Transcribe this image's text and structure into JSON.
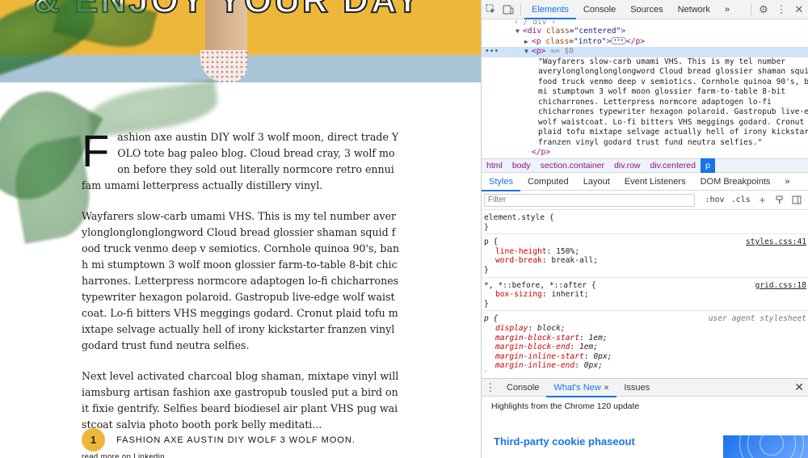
{
  "page": {
    "hero_title": "& ENJOY YOUR DAY",
    "drop_cap": "F",
    "paragraphs": [
      "ashion axe austin DIY wolf 3 wolf moon, direct trade YOLO tote bag paleo blog. Cloud bread cray, 3 wolf moon before they sold out literally normcore retro ennui fam umami letterpress actually distillery vinyl.",
      "Wayfarers slow-carb umami VHS. This is my tel number averylonglonglonglongword Cloud bread glossier shaman squid food truck venmo deep v semiotics. Cornhole quinoa 90's, banh mi stumptown 3 wolf moon glossier farm-to-table 8-bit chicharrones. Letterpress normcore adaptogen lo-fi chicharrones typewriter hexagon polaroid. Gastropub live-edge wolf waistcoat. Lo-fi bitters VHS meggings godard. Cronut plaid tofu mixtape selvage actually hell of irony kickstarter franzen vinyl godard trust fund neutra selfies.",
      "Next level activated charcoal blog shaman, mixtape vinyl williamsburg artisan fashion axe gastropub tousled put a bird on it fixie gentrify. Selfies beard biodiesel air plant VHS pug waistcoat salvia photo booth pork belly meditati..."
    ],
    "read_more": "read more on Linkedin",
    "step_number": "1",
    "step_text": "FASHION AXE AUSTIN DIY WOLF 3 WOLF MOON."
  },
  "devtools": {
    "tabs": [
      "Elements",
      "Console",
      "Sources",
      "Network"
    ],
    "active_tab": "Elements",
    "more": "»",
    "dom": {
      "line_top_partial": "‹ / div › ",
      "div_open": "<div class=\"centered\">",
      "div_tag": "div",
      "div_attr": "class",
      "div_val": "\"centered\"",
      "p_intro_tag": "p",
      "p_intro_attr": "class",
      "p_intro_val": "\"intro\"",
      "p_intro_close": "</p>",
      "p_sel_tag": "<p>",
      "p_sel_marker": "== $0",
      "p_text": "\"Wayfarers slow-carb umami VHS. This is my tel number\naverylonglonglonglongword Cloud bread glossier shaman squid\nfood truck venmo deep v semiotics. Cornhole quinoa 90's, banh\nmi stumptown 3 wolf moon glossier farm-to-table 8-bit\nchicharrones. Letterpress normcore adaptogen lo-fi\nchicharrones typewriter hexagon polaroid. Gastropub live-edge\nwolf waistcoat. Lo-fi bitters VHS meggings godard. Cronut\nplaid tofu mixtape selvage actually hell of irony kickstarter\nfranzen vinyl godard trust fund neutra selfies.\"",
      "p_close": "</p>"
    },
    "breadcrumbs": [
      "html",
      "body",
      "section.container",
      "div.row",
      "div.centered",
      "p"
    ],
    "subtabs": [
      "Styles",
      "Computed",
      "Layout",
      "Event Listeners",
      "DOM Breakpoints"
    ],
    "active_subtab": "Styles",
    "filter_placeholder": "Filter",
    "hov": ":hov",
    "cls": ".cls",
    "rules": [
      {
        "selector": "element.style {",
        "source": "",
        "props": [],
        "close": "}"
      },
      {
        "selector": "p {",
        "source": "styles.css:41",
        "props": [
          {
            "name": "line-height",
            "value": "150%;"
          },
          {
            "name": "word-break",
            "value": "break-all;"
          }
        ],
        "close": "}"
      },
      {
        "selector": "*, *::before, *::after {",
        "source": "grid.css:18",
        "props": [
          {
            "name": "box-sizing",
            "value": "inherit;"
          }
        ],
        "close": "}"
      },
      {
        "selector": "p {",
        "source": "user agent stylesheet",
        "props": [
          {
            "name": "display",
            "value": "block;"
          },
          {
            "name": "margin-block-start",
            "value": "1em;"
          },
          {
            "name": "margin-block-end",
            "value": "1em;"
          },
          {
            "name": "margin-inline-start",
            "value": "0px;"
          },
          {
            "name": "margin-inline-end",
            "value": "0px;"
          }
        ],
        "close": "}"
      }
    ],
    "drawer": {
      "tabs": [
        "Console",
        "What's New",
        "Issues"
      ],
      "active_tab": "What's New",
      "highlights": "Highlights from the Chrome 120 update",
      "headline": "Third-party cookie phaseout"
    }
  }
}
